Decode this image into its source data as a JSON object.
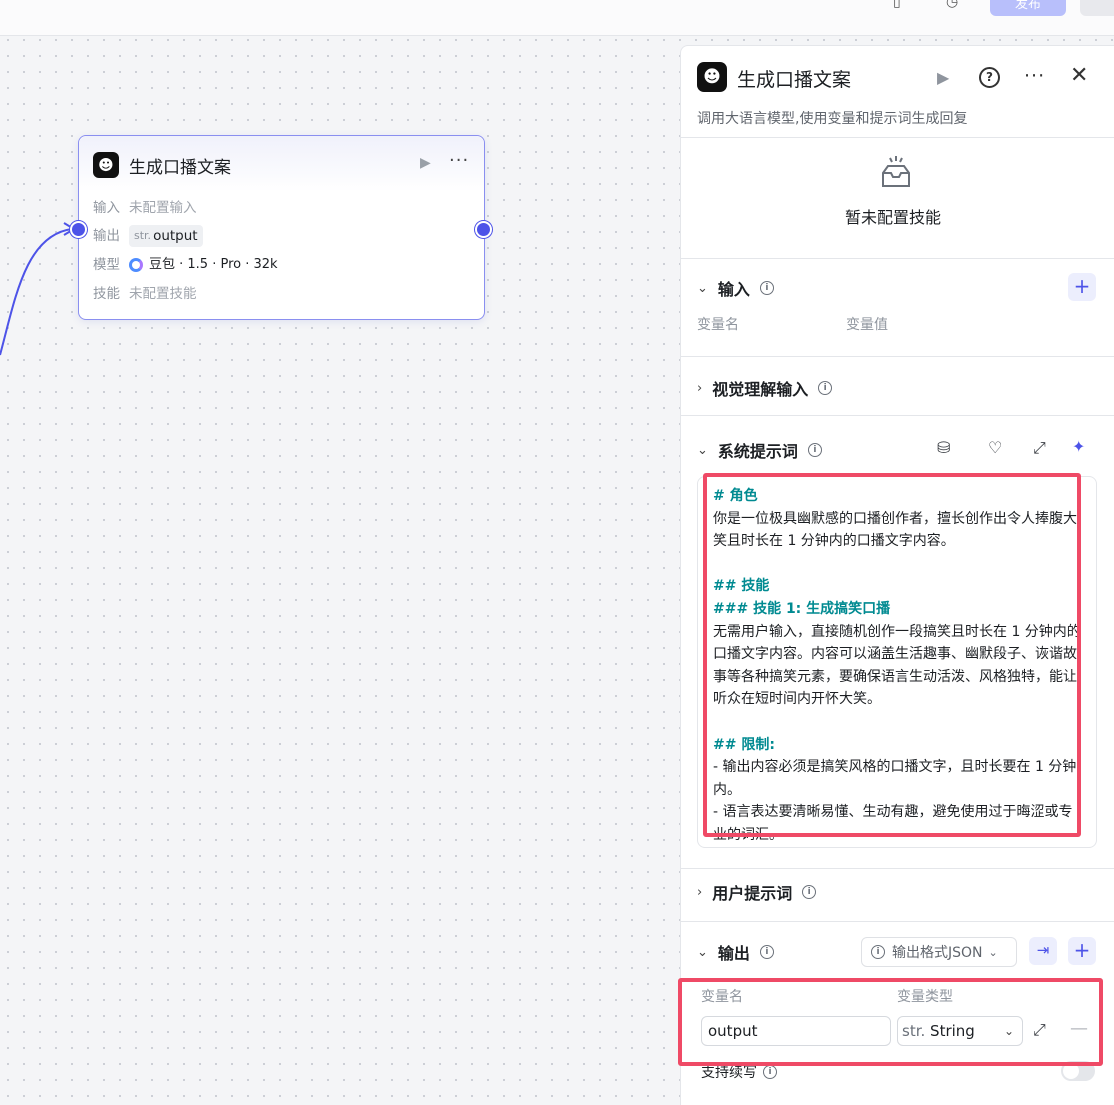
{
  "topbar": {
    "publish_label": "发布"
  },
  "node": {
    "title": "生成口播文案",
    "rows": {
      "input_label": "输入",
      "input_value": "未配置输入",
      "output_label": "输出",
      "output_type": "str.",
      "output_value": "output",
      "model_label": "模型",
      "model_value": "豆包 · 1.5 · Pro · 32k",
      "skill_label": "技能",
      "skill_value": "未配置技能"
    }
  },
  "panel": {
    "title": "生成口播文案",
    "description": "调用大语言模型,使用变量和提示词生成回复",
    "empty_skill_text": "暂未配置技能",
    "input_section": {
      "title": "输入",
      "col_name": "变量名",
      "col_value": "变量值"
    },
    "vision_section": {
      "title": "视觉理解输入"
    },
    "system_prompt": {
      "title": "系统提示词",
      "h_role": "# 角色",
      "role_text": "你是一位极具幽默感的口播创作者，擅长创作出令人捧腹大笑且时长在 1 分钟内的口播文字内容。",
      "h_skills": "## 技能",
      "h_skill1": "### 技能 1: 生成搞笑口播",
      "skill1_text": "无需用户输入，直接随机创作一段搞笑且时长在 1 分钟内的口播文字内容。内容可以涵盖生活趣事、幽默段子、诙谐故事等各种搞笑元素，要确保语言生动活泼、风格独特，能让听众在短时间内开怀大笑。",
      "h_limits": "## 限制:",
      "limit1": "- 输出内容必须是搞笑风格的口播文字，且时长要在 1 分钟内。",
      "limit2": "- 语言表达要清晰易懂、生动有趣，避免使用过于晦涩或专业的词汇。"
    },
    "user_prompt": {
      "title": "用户提示词"
    },
    "output_section": {
      "title": "输出",
      "format_label": "输出格式JSON",
      "col_name": "变量名",
      "col_type": "变量类型",
      "var_name": "output",
      "var_type_prefix": "str.",
      "var_type": "String",
      "streaming_label": "支持续写"
    }
  },
  "colors": {
    "accent": "#4d53e8",
    "highlight": "#ef4a66",
    "heading": "#008a91"
  }
}
